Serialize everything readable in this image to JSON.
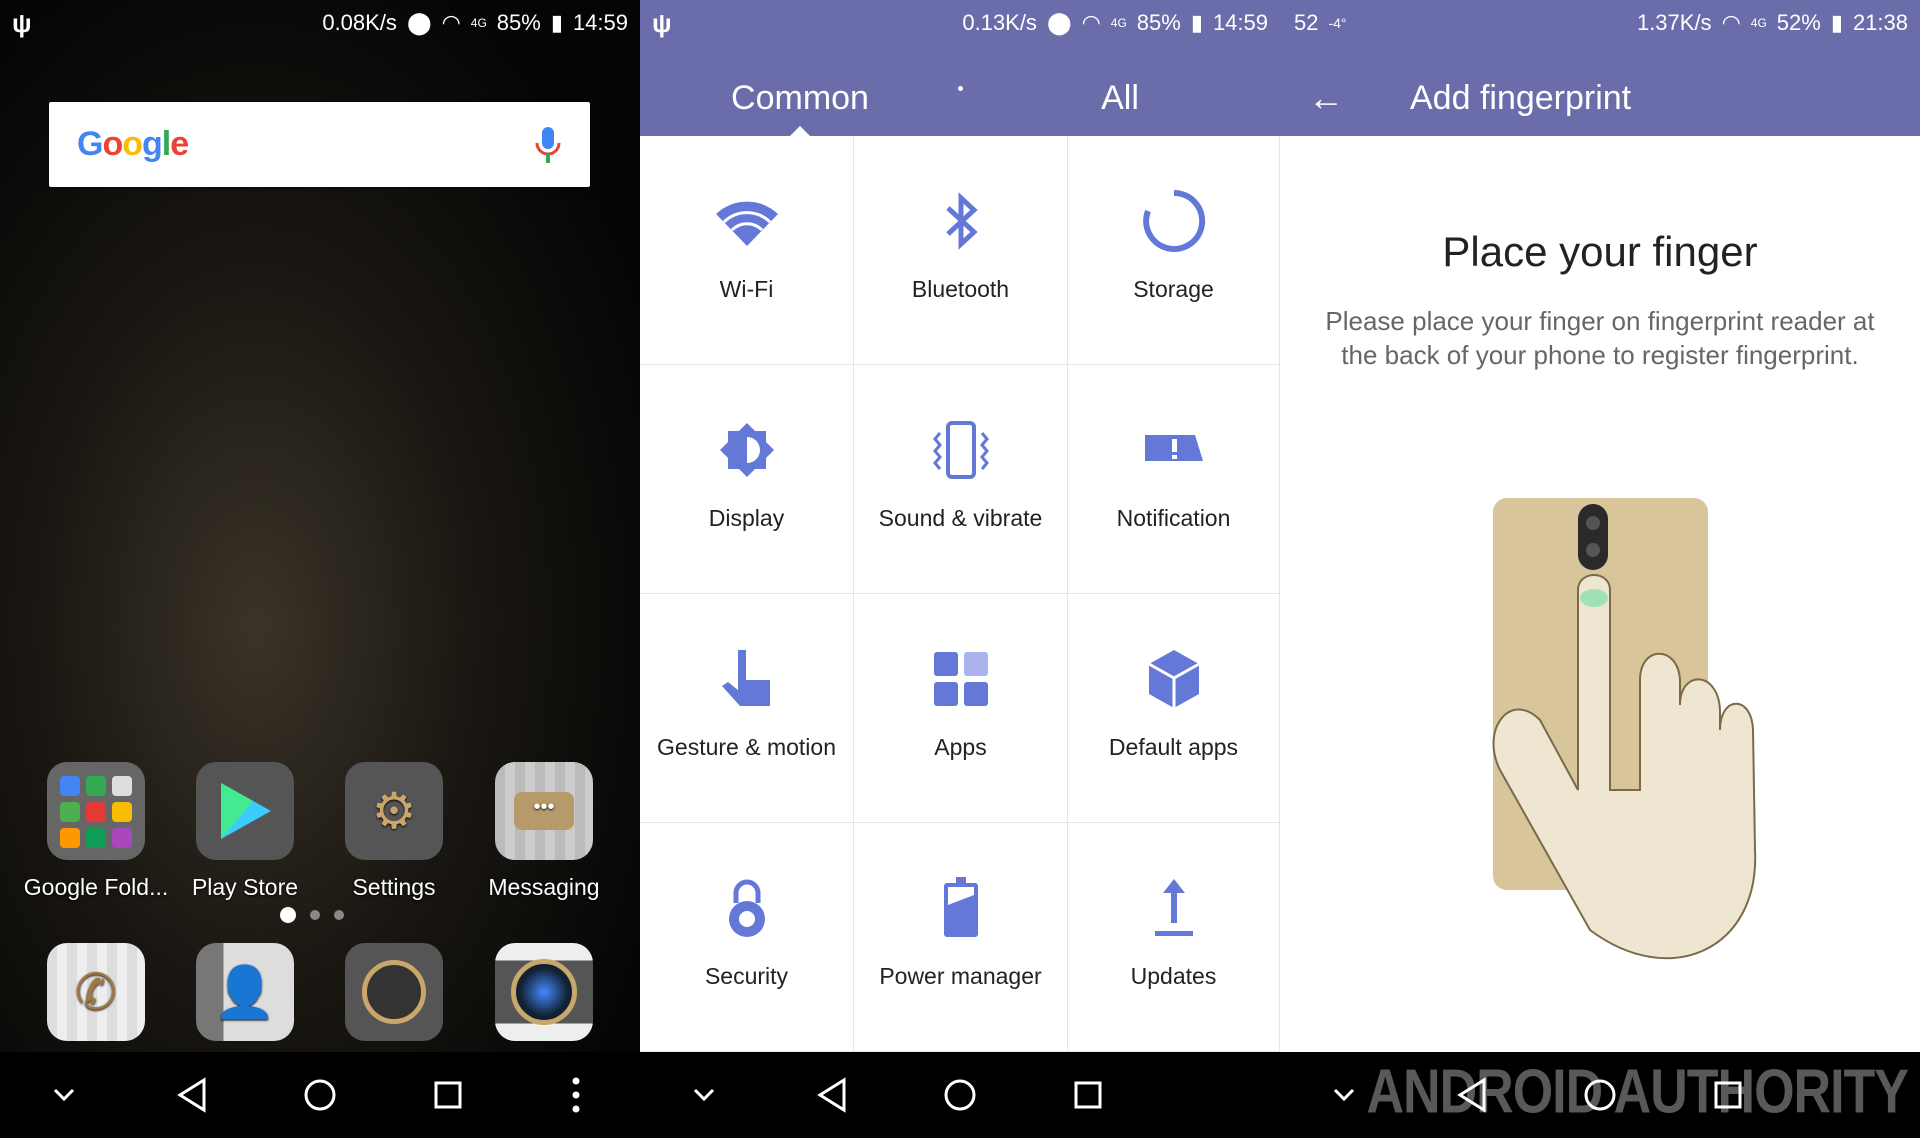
{
  "home": {
    "status": {
      "speed": "0.08K/s",
      "battery": "85%",
      "time": "14:59",
      "network": "4G"
    },
    "search": {
      "logo": "Google",
      "mic": "mic-icon"
    },
    "apps": [
      {
        "label": "Google Fold...",
        "icon": "folder-icon"
      },
      {
        "label": "Play Store",
        "icon": "play-store-icon"
      },
      {
        "label": "Settings",
        "icon": "gear-icon"
      },
      {
        "label": "Messaging",
        "icon": "message-icon"
      }
    ],
    "dock": [
      {
        "icon": "phone-icon"
      },
      {
        "icon": "contacts-icon"
      },
      {
        "icon": "gallery-icon"
      },
      {
        "icon": "camera-icon"
      }
    ],
    "page_indicator": {
      "current": 1,
      "total": 3
    }
  },
  "settings": {
    "status": {
      "speed": "0.13K/s",
      "battery": "85%",
      "time": "14:59",
      "network": "4G"
    },
    "tabs": [
      {
        "label": "Common",
        "active": true
      },
      {
        "label": "All",
        "active": false
      }
    ],
    "items": [
      {
        "label": "Wi-Fi",
        "icon": "wifi-icon"
      },
      {
        "label": "Bluetooth",
        "icon": "bluetooth-icon"
      },
      {
        "label": "Storage",
        "icon": "storage-icon"
      },
      {
        "label": "Display",
        "icon": "display-icon"
      },
      {
        "label": "Sound & vibrate",
        "icon": "vibrate-icon"
      },
      {
        "label": "Notification",
        "icon": "notification-icon"
      },
      {
        "label": "Gesture & motion",
        "icon": "gesture-icon"
      },
      {
        "label": "Apps",
        "icon": "apps-icon"
      },
      {
        "label": "Default apps",
        "icon": "cube-icon"
      },
      {
        "label": "Security",
        "icon": "lock-icon"
      },
      {
        "label": "Power manager",
        "icon": "battery-icon"
      },
      {
        "label": "Updates",
        "icon": "upload-icon"
      }
    ],
    "accent": "#6a6daa",
    "icon_color": "#6478d8"
  },
  "fingerprint": {
    "status": {
      "left1": "52",
      "left2": "-4°",
      "speed": "1.37K/s",
      "battery": "52%",
      "time": "21:38",
      "network": "4G"
    },
    "title": "Add fingerprint",
    "heading": "Place your finger",
    "description": "Please place your finger on fingerprint reader at the back of your phone to register fingerprint."
  },
  "watermark": "ANDROID AUTHORITY"
}
